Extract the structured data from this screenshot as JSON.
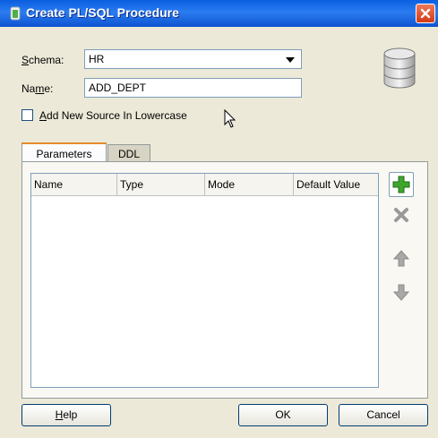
{
  "window": {
    "title": "Create PL/SQL Procedure"
  },
  "form": {
    "schema_label": "chema:",
    "schema_label_u": "S",
    "schema_value": "HR",
    "name_label": "Na",
    "name_label_u": "m",
    "name_label_rest": "e:",
    "name_value": "ADD_DEPT",
    "lowercase_label_u": "A",
    "lowercase_label": "dd New Source In Lowercase"
  },
  "tabs": [
    {
      "label": "Parameters",
      "selected": true
    },
    {
      "label": "DDL",
      "selected": false
    }
  ],
  "table": {
    "columns": [
      "Name",
      "Type",
      "Mode",
      "Default Value"
    ]
  },
  "side_buttons": {
    "add": "add-icon",
    "remove": "remove-icon",
    "move_up": "up-arrow-icon",
    "move_down": "down-arrow-icon"
  },
  "buttons": {
    "help_u": "H",
    "help": "elp",
    "ok": "OK",
    "cancel": "Cancel"
  },
  "colors": {
    "titlebar": "#0a5fe0",
    "dialog_bg": "#ece9d8",
    "accent_tab": "#e68b2c",
    "add_green": "#3fa62c"
  }
}
